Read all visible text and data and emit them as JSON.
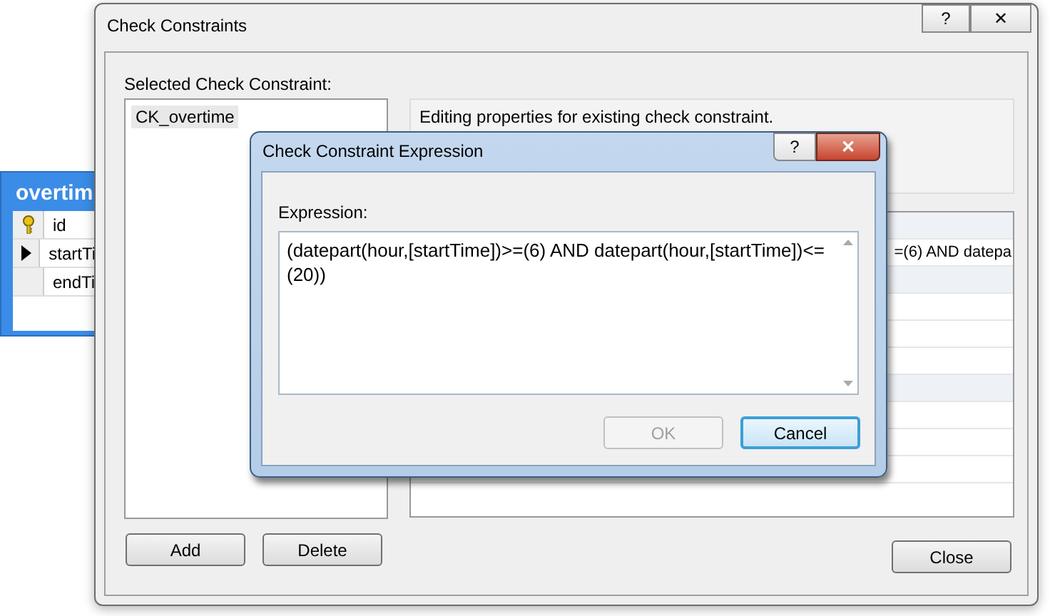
{
  "table_widget": {
    "title": "overtim",
    "rows": [
      {
        "name": "id",
        "kind": "key"
      },
      {
        "name": "startTi",
        "kind": "current"
      },
      {
        "name": "endTi",
        "kind": "plain"
      }
    ]
  },
  "main_dialog": {
    "title": "Check Constraints",
    "help_button": "?",
    "close_button": "✕",
    "list_label": "Selected Check Constraint:",
    "constraints": [
      {
        "name": "CK_overtime",
        "selected": true
      }
    ],
    "description": "Editing properties for existing check constraint.",
    "property_grid": {
      "rows": [
        {
          "kind": "category"
        },
        {
          "kind": "property",
          "value": "=(6) AND datepa"
        },
        {
          "kind": "category"
        },
        {
          "kind": "property"
        },
        {
          "kind": "property"
        },
        {
          "kind": "property"
        },
        {
          "kind": "category"
        },
        {
          "kind": "property"
        },
        {
          "kind": "property"
        },
        {
          "kind": "property"
        }
      ]
    },
    "buttons": [
      {
        "label": "Add"
      },
      {
        "label": "Delete"
      }
    ],
    "close_label": "Close"
  },
  "expression_dialog": {
    "title": "Check Constraint Expression",
    "help_button": "?",
    "close_button": "✕",
    "label": "Expression:",
    "expression": "(datepart(hour,[startTime])>=(6) AND datepart(hour,[startTime])<=(20))",
    "buttons": [
      {
        "label": "OK",
        "disabled": true,
        "focused": false
      },
      {
        "label": "Cancel",
        "disabled": false,
        "focused": true
      }
    ]
  }
}
